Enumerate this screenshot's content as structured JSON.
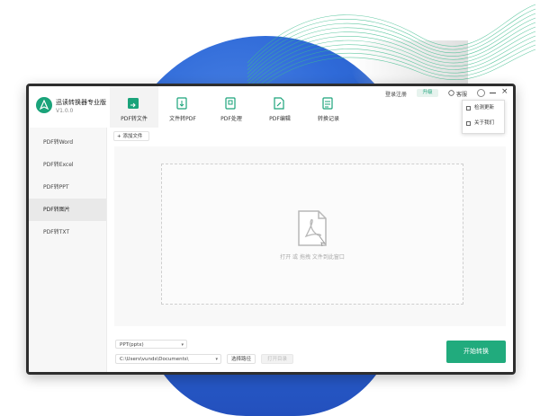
{
  "app": {
    "name": "迅读转换器专业版",
    "version": "V1.0.0"
  },
  "header": {
    "tabs": [
      {
        "label": "PDF转文件",
        "icon": "pdf-convert-icon",
        "active": true
      },
      {
        "label": "文件转PDF",
        "icon": "file-to-pdf-icon",
        "active": false
      },
      {
        "label": "PDF处理",
        "icon": "pdf-process-icon",
        "active": false
      },
      {
        "label": "PDF编辑",
        "icon": "pdf-edit-icon",
        "active": false
      },
      {
        "label": "转换记录",
        "icon": "history-icon",
        "active": false
      }
    ],
    "login_label": "登录注册",
    "upgrade_label": "升级",
    "service_label": "客服"
  },
  "dropdown": {
    "items": [
      {
        "label": "检测更新",
        "icon": "update-icon"
      },
      {
        "label": "关于我们",
        "icon": "about-icon"
      }
    ]
  },
  "sidebar": {
    "items": [
      {
        "label": "PDF转Word",
        "active": false
      },
      {
        "label": "PDF转Excel",
        "active": false
      },
      {
        "label": "PDF转PPT",
        "active": false
      },
      {
        "label": "PDF转图片",
        "active": true
      },
      {
        "label": "PDF转TXT",
        "active": false
      }
    ]
  },
  "main": {
    "add_file_label": "+ 添加文件",
    "drop_hint": "打开 或 拖拽 文件到此窗口",
    "format_value": "PPT(pptx)",
    "path_value": "C:\\Users\\vunds\\Documents\\",
    "choose_path_label": "选择路径",
    "open_dir_label": "打开目录",
    "start_label": "开始转换"
  },
  "colors": {
    "accent": "#21ab7d",
    "window_border": "#2e2e2e",
    "bg_circle": "#2f6ad8"
  }
}
